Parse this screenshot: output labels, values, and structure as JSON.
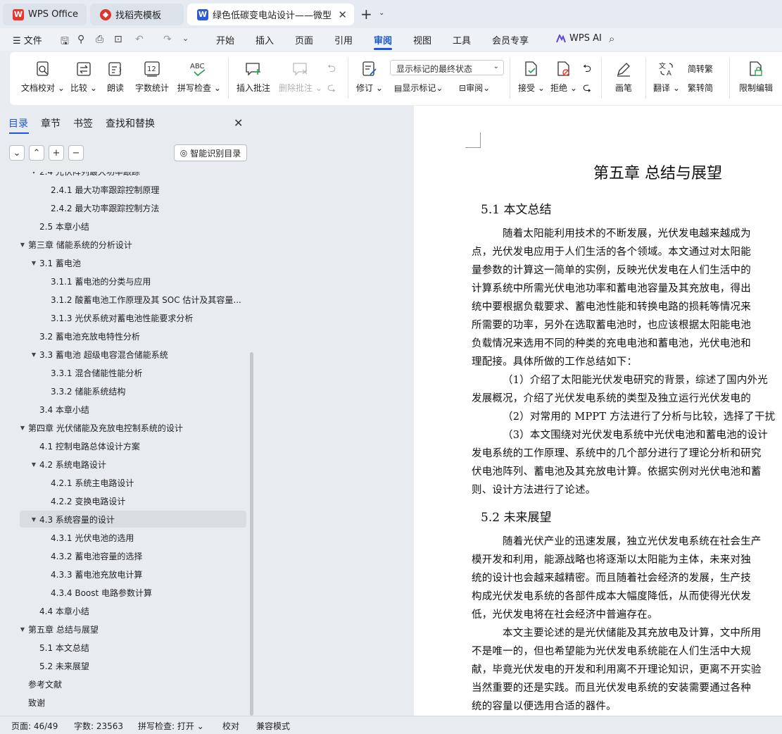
{
  "tabs": [
    {
      "label": "WPS Office"
    },
    {
      "label": "找稻壳模板"
    },
    {
      "label": "绿色低碳变电站设计——微型"
    }
  ],
  "menu": {
    "file": "文件",
    "items": [
      "开始",
      "插入",
      "页面",
      "引用",
      "审阅",
      "视图",
      "工具",
      "会员专享"
    ],
    "wps_ai": "WPS AI"
  },
  "ribbon": {
    "doc_check": "文档校对",
    "compare": "比较",
    "read_aloud": "朗读",
    "word_count": "字数统计",
    "spell_check": "拼写检查",
    "insert_comment": "插入批注",
    "delete_comment": "删除批注",
    "track": "修订",
    "markup_select": "显示标记的最终状态",
    "show_markup": "显示标记",
    "review": "审阅",
    "accept": "接受",
    "reject": "拒绝",
    "pen": "画笔",
    "translate": "翻译",
    "to_traditional": "转繁",
    "to_simplified": "转简",
    "restrict_edit": "限制编辑"
  },
  "sidebar": {
    "tabs": [
      "目录",
      "章节",
      "书签",
      "查找和替换"
    ],
    "smart_toc": "智能识别目录",
    "toc": [
      {
        "label": "2.4 光伏阵列最大功率跟踪",
        "level": 2,
        "toggle": "▼"
      },
      {
        "label": "2.4.1 最大功率跟踪控制原理",
        "level": 3
      },
      {
        "label": "2.4.2  最大功率跟踪控制方法",
        "level": 3
      },
      {
        "label": "2.5  本章小结",
        "level": 2
      },
      {
        "label": "第三章  储能系统的分析设计",
        "level": 1,
        "toggle": "▼"
      },
      {
        "label": "3.1  蓄电池",
        "level": 2,
        "toggle": "▼"
      },
      {
        "label": "3.1.1 蓄电池的分类与应用",
        "level": 3
      },
      {
        "label": "3.1.2 酸蓄电池工作原理及其 SOC 估计及其容量...",
        "level": 3
      },
      {
        "label": "3.1.3  光伏系统对蓄电池性能要求分析",
        "level": 3
      },
      {
        "label": "3.2 蓄电池充放电特性分析",
        "level": 2
      },
      {
        "label": "3.3  蓄电池  超级电容混合储能系统",
        "level": 2,
        "toggle": "▼"
      },
      {
        "label": "3.3.1  混合储能性能分析",
        "level": 3
      },
      {
        "label": "3.3.2  储能系统结构",
        "level": 3
      },
      {
        "label": "3.4 本章小结",
        "level": 2
      },
      {
        "label": "第四章  光伏储能及充放电控制系统的设计",
        "level": 1,
        "toggle": "▼"
      },
      {
        "label": "4.1 控制电路总体设计方案",
        "level": 2
      },
      {
        "label": "4.2 系统电路设计",
        "level": 2,
        "toggle": "▼"
      },
      {
        "label": "4.2.1 系统主电路设计",
        "level": 3
      },
      {
        "label": "4.2.2  变换电路设计",
        "level": 3
      },
      {
        "label": "4.3 系统容量的设计",
        "level": 2,
        "toggle": "▼",
        "selected": true
      },
      {
        "label": "4.3.1 光伏电池的选用",
        "level": 3
      },
      {
        "label": "4.3.2 蓄电池容量的选择",
        "level": 3
      },
      {
        "label": "4.3.3 蓄电池充放电计算",
        "level": 3
      },
      {
        "label": "4.3.4 Boost 电路参数计算",
        "level": 3
      },
      {
        "label": "4.4 本章小结",
        "level": 2
      },
      {
        "label": "第五章  总结与展望",
        "level": 1,
        "toggle": "▼"
      },
      {
        "label": "5.1  本文总结",
        "level": 2
      },
      {
        "label": "5.2 未来展望",
        "level": 2
      },
      {
        "label": "参考文献",
        "level": 1
      },
      {
        "label": "致谢",
        "level": 1
      }
    ]
  },
  "document": {
    "chapter_title": "第五章  总结与展望",
    "sections": [
      {
        "heading": "5.1  本文总结",
        "lines": [
          {
            "text": "随着太阳能利用技术的不断发展，光伏发电越来越成为",
            "indent": true
          },
          {
            "text": "点，光伏发电应用于人们生活的各个领域。本文通过对太阳能"
          },
          {
            "text": "量参数的计算这一简单的实例，反映光伏发电在人们生活中的"
          },
          {
            "text": "计算系统中所需光伏电池功率和蓄电池容量及其充放电，得出"
          },
          {
            "text": "统中要根据负载要求、蓄电池性能和转换电路的损耗等情况来"
          },
          {
            "text": "所需要的功率，另外在选取蓄电池时，也应该根据太阳能电池"
          },
          {
            "text": "负载情况来选用不同的种类的充电电池和蓄电池，光伏电池和"
          },
          {
            "text": "理配接。具体所做的工作总结如下："
          },
          {
            "text": "（1）介绍了太阳能光伏发电研究的背景，综述了国内外光",
            "indent": true
          },
          {
            "text": "发展概况，介绍了光伏发电系统的类型及独立运行光伏发电的"
          },
          {
            "text": "（2）对常用的 MPPT 方法进行了分析与比较，选择了干扰",
            "indent": true
          },
          {
            "text": "（3）本文围绕对光伏发电系统中光伏电池和蓄电池的设计",
            "indent": true
          },
          {
            "text": "发电系统的工作原理、系统中的几个部分进行了理论分析和研究"
          },
          {
            "text": "伏电池阵列、蓄电池及其充放电计算。依据实例对光伏电池和蓄"
          },
          {
            "text": "则、设计方法进行了论述。"
          }
        ]
      },
      {
        "heading": "5.2 未来展望",
        "lines": [
          {
            "text": "随着光伏产业的迅速发展，独立光伏发电系统在社会生产",
            "indent": true
          },
          {
            "text": "模开发和利用，能源战略也将逐渐以太阳能为主体，未来对独"
          },
          {
            "text": "统的设计也会越来越精密。而且随着社会经济的发展，生产技"
          },
          {
            "text": "构成光伏发电系统的各部件成本大幅度降低，从而使得光伏发"
          },
          {
            "text": "低，光伏发电将在社会经济中普遍存在。"
          },
          {
            "text": "本文主要论述的是光伏储能及其充放电及计算，文中所用",
            "indent": true
          },
          {
            "text": "不是唯一的，但也希望能为光伏发电系统能在人们生活中大规"
          },
          {
            "text": "献，毕竟光伏发电的开发和利用离不开理论知识，更离不开实验"
          },
          {
            "text": "当然重要的还是实践。而且光伏发电系统的安装需要通过各种"
          },
          {
            "text": "统的容量以便选用合适的器件。"
          }
        ]
      }
    ]
  },
  "status": {
    "page": "页面: 46/49",
    "words": "字数: 23563",
    "spell": "拼写检查: 打开",
    "proof": "校对",
    "compat": "兼容模式"
  },
  "colors": {
    "accent": "#1a57d6",
    "wps_red": "#e8362c",
    "docer_red": "#d9362c",
    "word_blue": "#2b5bd7"
  }
}
